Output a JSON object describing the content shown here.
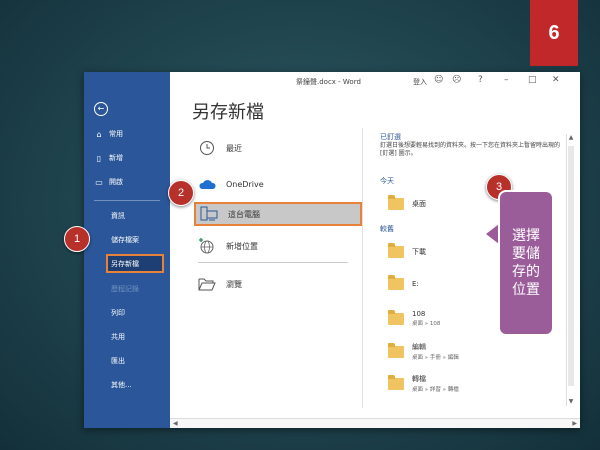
{
  "page_number": "6",
  "window": {
    "doc_title": "祭鐘聲.docx - Word",
    "user_name": "登入",
    "help": "?",
    "min": "–",
    "max": "□",
    "close": "✕"
  },
  "sidebar": {
    "back": "←",
    "items": [
      {
        "label": "常用",
        "icon": "home-icon"
      },
      {
        "label": "新增",
        "icon": "new-doc-icon"
      },
      {
        "label": "開啟",
        "icon": "open-folder-icon"
      }
    ],
    "sub_items": [
      "資訊",
      "儲存檔案",
      "另存新檔",
      "歷程記錄",
      "列印",
      "共用",
      "匯出",
      "其他..."
    ]
  },
  "page_title": "另存新檔",
  "locations": [
    {
      "label": "最近",
      "icon": "clock-icon"
    },
    {
      "label": "OneDrive",
      "icon": "cloud-icon"
    },
    {
      "label": "這台電腦",
      "icon": "computer-icon"
    },
    {
      "label": "新增位置",
      "icon": "globe-plus-icon"
    },
    {
      "label": "瀏覽",
      "icon": "folder-open-icon"
    }
  ],
  "right": {
    "pinned_head": "已釘選",
    "pinned_desc": "釘選日後想要輕易找到的資料夾。按一下您在資料夾上暫留時出現的 [釘選] 圖示。",
    "today_head": "今天",
    "older_head": "較舊",
    "today_folders": [
      {
        "name": "桌面",
        "path": ""
      }
    ],
    "older_folders": [
      {
        "name": "下載",
        "path": ""
      },
      {
        "name": "E:",
        "path": ""
      },
      {
        "name": "108",
        "path": "桌面 » 108"
      },
      {
        "name": "編輯",
        "path": "桌面 » 手冊 » 編輯"
      },
      {
        "name": "轉檔",
        "path": "桌面 » 詳習 » 轉檔"
      }
    ]
  },
  "callouts": [
    "1",
    "2",
    "3"
  ],
  "tip_text": [
    "選擇",
    "要儲",
    "存的",
    "位置"
  ],
  "colors": {
    "accent": "#2b579a",
    "highlight": "#e8823a",
    "callout": "#b7302a",
    "tip": "#9a5d9a"
  }
}
